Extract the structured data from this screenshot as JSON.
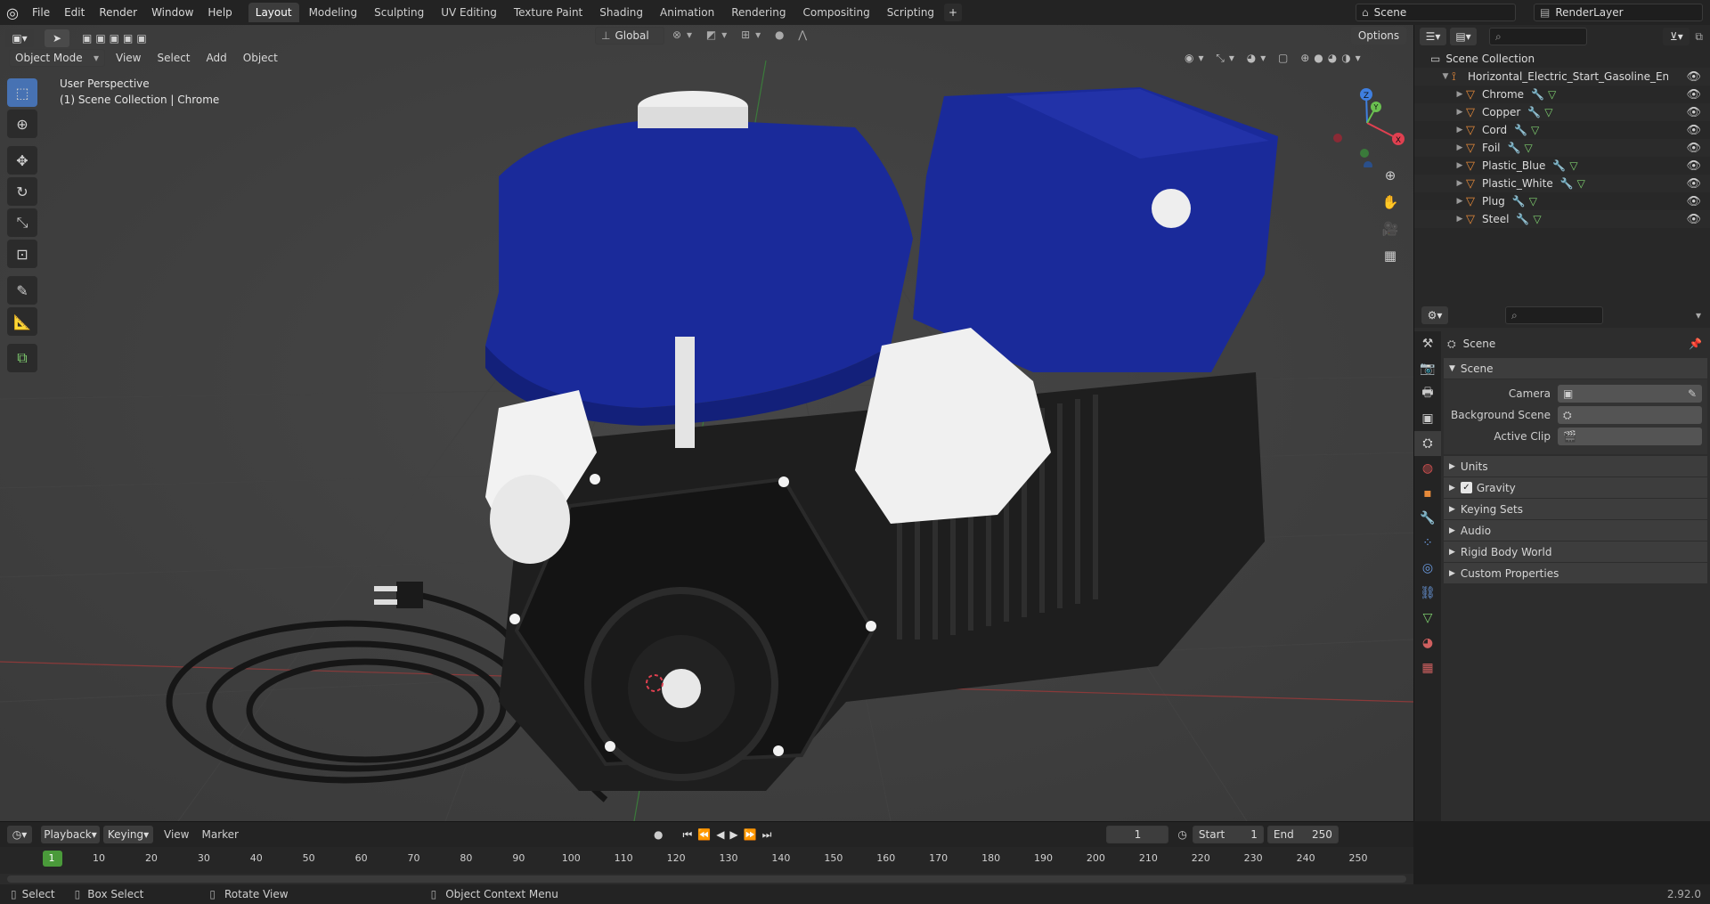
{
  "menu": [
    "File",
    "Edit",
    "Render",
    "Window",
    "Help"
  ],
  "workspaces": [
    "Layout",
    "Modeling",
    "Sculpting",
    "UV Editing",
    "Texture Paint",
    "Shading",
    "Animation",
    "Rendering",
    "Compositing",
    "Scripting"
  ],
  "active_workspace": "Layout",
  "scene_field": "Scene",
  "renderlayer_field": "RenderLayer",
  "viewport": {
    "mode": "Object Mode",
    "menu": [
      "View",
      "Select",
      "Add",
      "Object"
    ],
    "orientation": "Global",
    "options_label": "Options",
    "perspective_label": "User Perspective",
    "collection_label": "(1) Scene Collection | Chrome",
    "axis_x": "X",
    "axis_y": "Y",
    "axis_z": "Z"
  },
  "outliner": {
    "root": "Scene Collection",
    "parent": "Horizontal_Electric_Start_Gasoline_Engine_E",
    "items": [
      "Chrome",
      "Copper",
      "Cord",
      "Foil",
      "Plastic_Blue",
      "Plastic_White",
      "Plug",
      "Steel"
    ]
  },
  "properties": {
    "context": "Scene",
    "panel_title": "Scene",
    "camera_label": "Camera",
    "background_label": "Background Scene",
    "active_clip_label": "Active Clip",
    "subpanels": [
      "Units",
      "Gravity",
      "Keying Sets",
      "Audio",
      "Rigid Body World",
      "Custom Properties"
    ],
    "gravity_checked": true
  },
  "timeline": {
    "menus": [
      "Playback",
      "Keying",
      "View",
      "Marker"
    ],
    "current_frame": "1",
    "start_label": "Start",
    "start_value": "1",
    "end_label": "End",
    "end_value": "250",
    "ticks": [
      "1",
      "10",
      "20",
      "30",
      "40",
      "50",
      "60",
      "70",
      "80",
      "90",
      "100",
      "110",
      "120",
      "130",
      "140",
      "150",
      "160",
      "170",
      "180",
      "190",
      "200",
      "210",
      "220",
      "230",
      "240",
      "250"
    ]
  },
  "statusbar": {
    "select": "Select",
    "box_select": "Box Select",
    "rotate": "Rotate View",
    "context_menu": "Object Context Menu",
    "version": "2.92.0"
  },
  "colors": {
    "accent": "#4772b3",
    "engine_blue": "#1a2a9a",
    "x_axis": "#e04050",
    "y_axis": "#6ac050",
    "z_axis": "#3f7fe0"
  }
}
